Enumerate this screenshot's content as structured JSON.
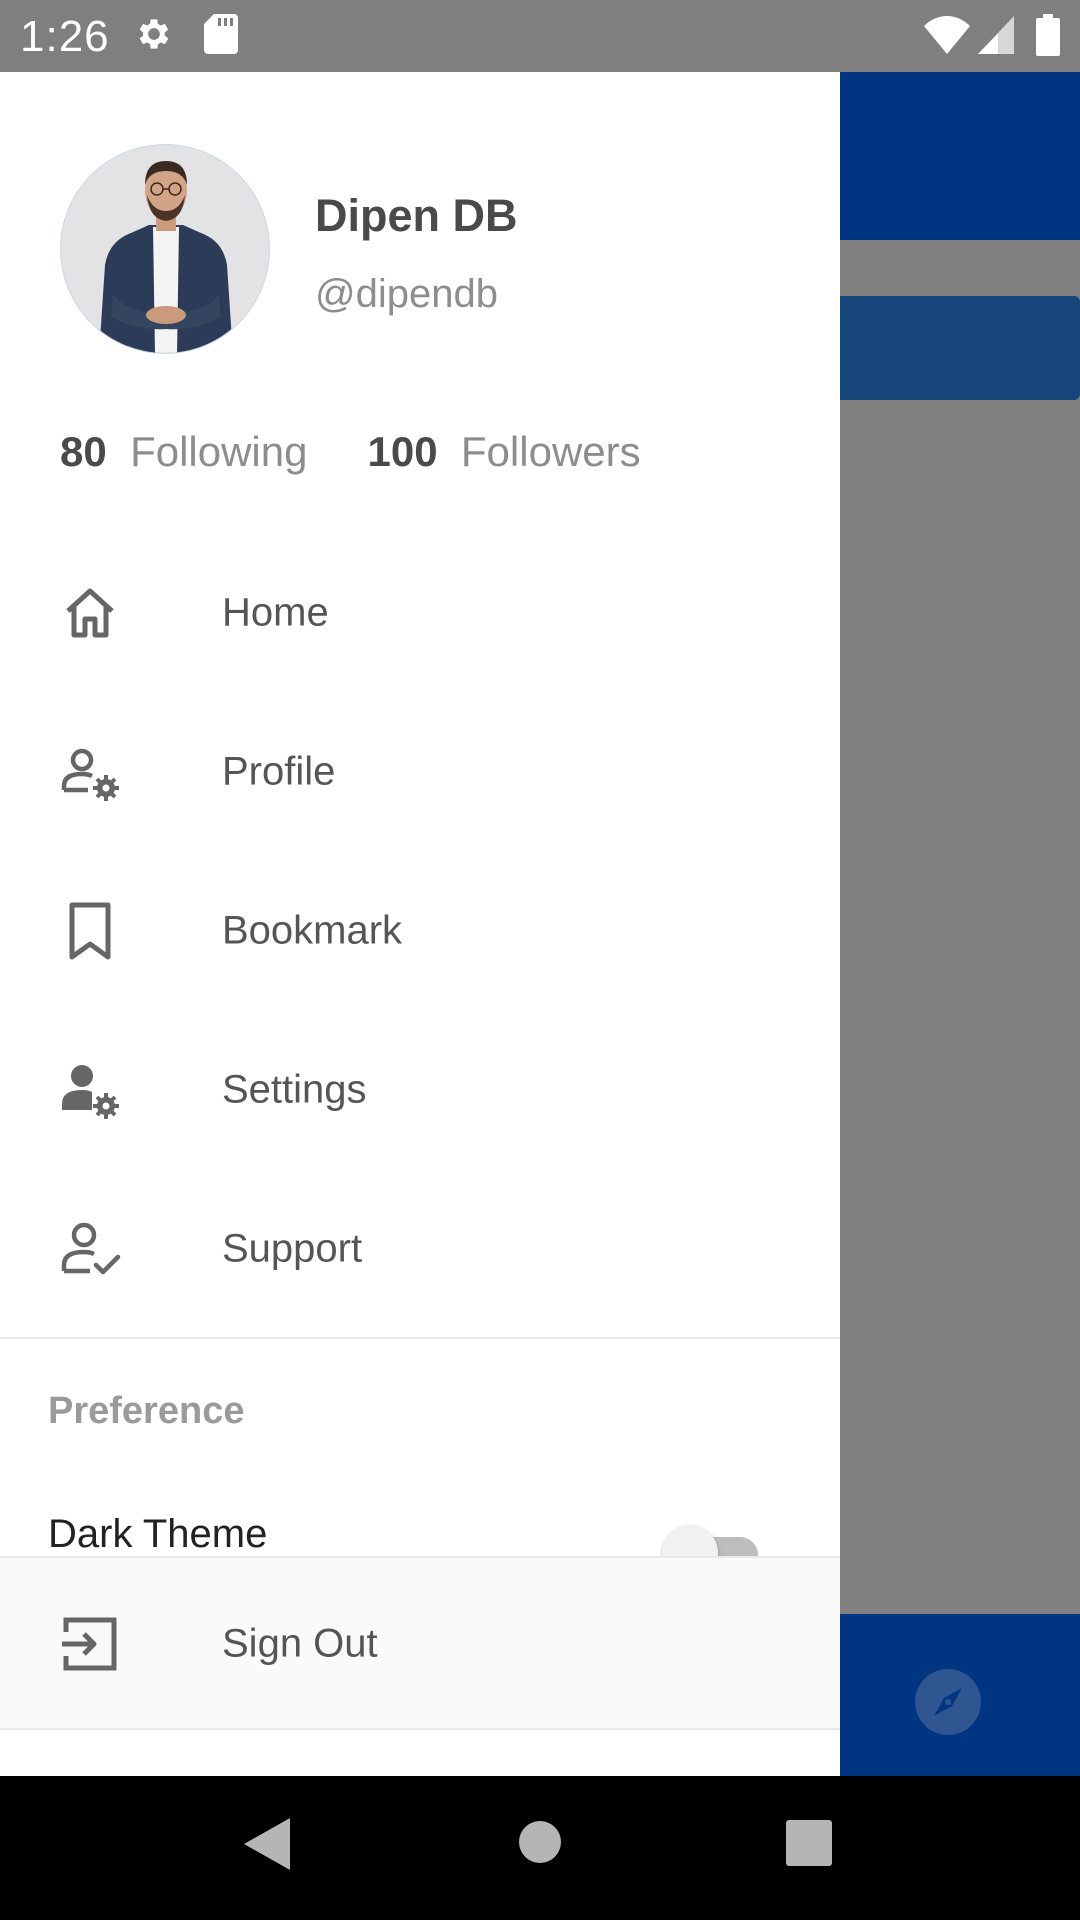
{
  "status_bar": {
    "time": "1:26",
    "icons": [
      "settings-icon",
      "sd-card-icon",
      "wifi-icon",
      "signal-icon",
      "battery-icon"
    ]
  },
  "profile": {
    "name": "Dipen DB",
    "handle": "@dipendb"
  },
  "stats": {
    "following_count": "80",
    "following_label": "Following",
    "followers_count": "100",
    "followers_label": "Followers"
  },
  "menu": [
    {
      "label": "Home",
      "icon": "home-icon"
    },
    {
      "label": "Profile",
      "icon": "user-settings-outline-icon"
    },
    {
      "label": "Bookmark",
      "icon": "bookmark-icon"
    },
    {
      "label": "Settings",
      "icon": "user-cog-icon"
    },
    {
      "label": "Support",
      "icon": "user-check-icon"
    }
  ],
  "preference": {
    "title": "Preference",
    "dark_theme_label": "Dark Theme",
    "dark_theme_enabled": false
  },
  "sign_out": {
    "label": "Sign Out",
    "icon": "sign-out-icon"
  },
  "colors": {
    "drawer_bg": "#ffffff",
    "scrim": "#7f7f7f",
    "app_primary": "#003581",
    "text_dark": "#4a4a4a",
    "text_muted": "#8d8d8d"
  }
}
